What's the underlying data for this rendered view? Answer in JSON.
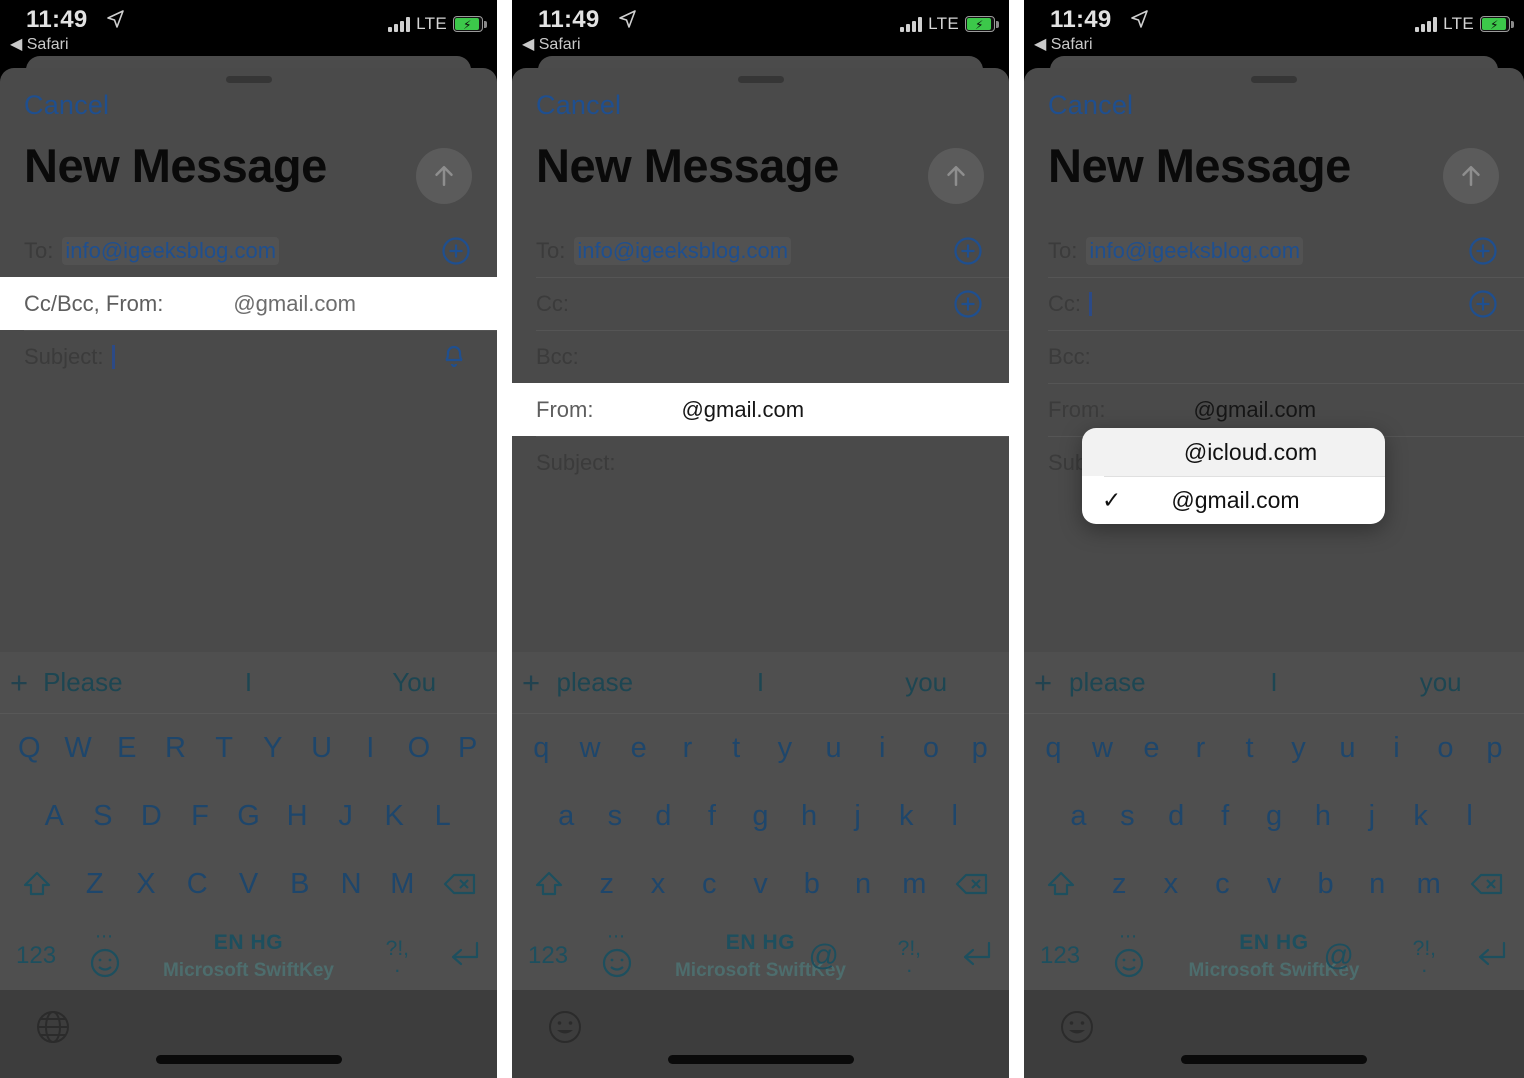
{
  "status_bar": {
    "time": "11:49",
    "back_app": "◀ Safari",
    "carrier_tech": "LTE",
    "location_icon": "location-arrow-icon",
    "signal_icon": "signal-bars-icon",
    "battery_icon": "battery-charging-icon"
  },
  "compose": {
    "cancel_label": "Cancel",
    "title": "New Message",
    "send_icon": "send-arrow-up-icon",
    "add_contact_icon": "plus-circle-icon",
    "notify_icon": "bell-icon",
    "labels": {
      "to": "To:",
      "cc_bcc_from": "Cc/Bcc, From:",
      "cc": "Cc:",
      "bcc": "Bcc:",
      "from": "From:",
      "subject": "Subject:"
    },
    "values": {
      "to": "info@igeeksblog.com",
      "from": "@gmail.com",
      "cc": "",
      "bcc": "",
      "subject": ""
    }
  },
  "account_dropdown": {
    "options": [
      {
        "label": "@icloud.com",
        "selected": false
      },
      {
        "label": "@gmail.com",
        "selected": true
      }
    ],
    "check_glyph": "✓"
  },
  "keyboard": {
    "suggestions_upper": [
      "Please",
      "I",
      "You"
    ],
    "suggestions_lower": [
      "please",
      "I",
      "you"
    ],
    "add_suggestion_icon": "plus-icon",
    "rows_upper": {
      "r1": [
        "Q",
        "W",
        "E",
        "R",
        "T",
        "Y",
        "U",
        "I",
        "O",
        "P"
      ],
      "r2": [
        "A",
        "S",
        "D",
        "F",
        "G",
        "H",
        "J",
        "K",
        "L"
      ],
      "r3": [
        "Z",
        "X",
        "C",
        "V",
        "B",
        "N",
        "M"
      ]
    },
    "rows_lower": {
      "r1": [
        "q",
        "w",
        "e",
        "r",
        "t",
        "y",
        "u",
        "i",
        "o",
        "p"
      ],
      "r2": [
        "a",
        "s",
        "d",
        "f",
        "g",
        "h",
        "j",
        "k",
        "l"
      ],
      "r3": [
        "z",
        "x",
        "c",
        "v",
        "b",
        "n",
        "m"
      ]
    },
    "shift_icon": "shift-up-arrow-icon",
    "backspace_icon": "backspace-delete-icon",
    "numbers_key": "123",
    "emoji_icon": "smiley-face-icon",
    "emoji_dots": "⋯",
    "space_language": "EN HG",
    "space_brand": "Microsoft SwiftKey",
    "at_key": "@",
    "punct_top": "?!,",
    "punct_bottom": ".",
    "return_icon": "return-enter-icon"
  },
  "bottom_bar": {
    "globe_icon": "globe-language-icon",
    "emoji_icon": "smiley-face-icon",
    "home_indicator": "home-indicator-bar"
  },
  "panels": [
    {
      "id": "panel1",
      "highlighted_row": "cc_bcc_from",
      "bottom_icon": "globe-language-icon",
      "shift_state": "uppercase",
      "has_at_key": false
    },
    {
      "id": "panel2",
      "highlighted_row": "from",
      "bottom_icon": "smiley-face-icon",
      "shift_state": "lowercase",
      "has_at_key": true
    },
    {
      "id": "panel3",
      "highlighted_row": "none",
      "bottom_icon": "smiley-face-icon",
      "shift_state": "lowercase",
      "has_at_key": true,
      "dropdown_open": true
    }
  ],
  "colors": {
    "accent_blue": "#1f4f8f",
    "sheet_gray": "#4a4a4a",
    "keyboard_gray": "#4f4f4f",
    "battery_green": "#3cc84a",
    "key_ink": "#1e466b"
  }
}
